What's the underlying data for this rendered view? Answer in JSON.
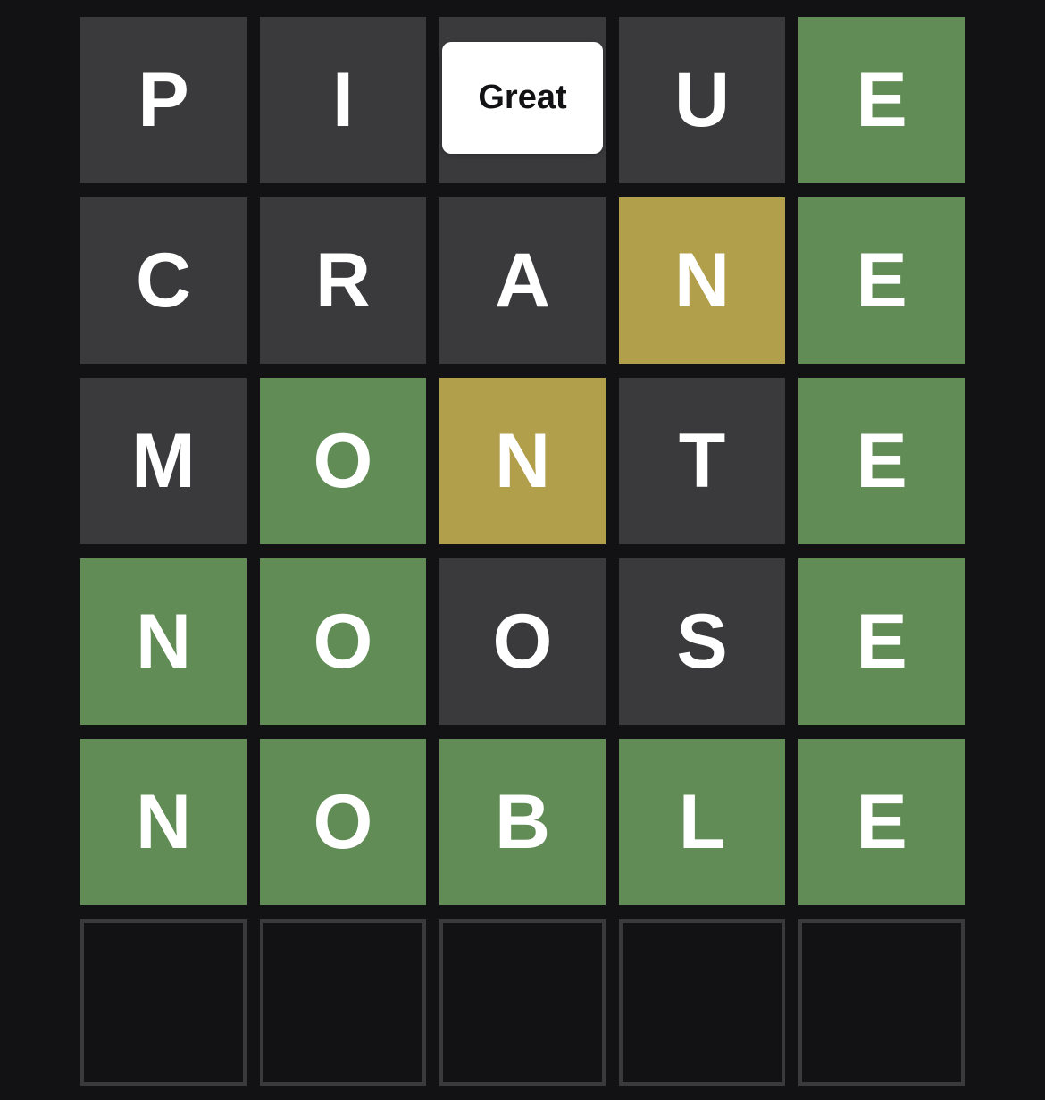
{
  "board": {
    "rows": [
      [
        {
          "letter": "P",
          "state": "absent"
        },
        {
          "letter": "I",
          "state": "absent"
        },
        {
          "letter": "",
          "state": "absent"
        },
        {
          "letter": "U",
          "state": "absent"
        },
        {
          "letter": "E",
          "state": "correct"
        }
      ],
      [
        {
          "letter": "C",
          "state": "absent"
        },
        {
          "letter": "R",
          "state": "absent"
        },
        {
          "letter": "A",
          "state": "absent"
        },
        {
          "letter": "N",
          "state": "present"
        },
        {
          "letter": "E",
          "state": "correct"
        }
      ],
      [
        {
          "letter": "M",
          "state": "absent"
        },
        {
          "letter": "O",
          "state": "correct"
        },
        {
          "letter": "N",
          "state": "present"
        },
        {
          "letter": "T",
          "state": "absent"
        },
        {
          "letter": "E",
          "state": "correct"
        }
      ],
      [
        {
          "letter": "N",
          "state": "correct"
        },
        {
          "letter": "O",
          "state": "correct"
        },
        {
          "letter": "O",
          "state": "absent"
        },
        {
          "letter": "S",
          "state": "absent"
        },
        {
          "letter": "E",
          "state": "correct"
        }
      ],
      [
        {
          "letter": "N",
          "state": "correct"
        },
        {
          "letter": "O",
          "state": "correct"
        },
        {
          "letter": "B",
          "state": "correct"
        },
        {
          "letter": "L",
          "state": "correct"
        },
        {
          "letter": "E",
          "state": "correct"
        }
      ],
      [
        {
          "letter": "",
          "state": "empty"
        },
        {
          "letter": "",
          "state": "empty"
        },
        {
          "letter": "",
          "state": "empty"
        },
        {
          "letter": "",
          "state": "empty"
        },
        {
          "letter": "",
          "state": "empty"
        }
      ]
    ]
  },
  "toast": {
    "text": "Great"
  },
  "colors": {
    "background": "#121214",
    "absent": "#3a3a3c",
    "present": "#b19f4c",
    "correct": "#618c55",
    "empty_border": "#3a3a3c",
    "toast_background": "#ffffff"
  }
}
